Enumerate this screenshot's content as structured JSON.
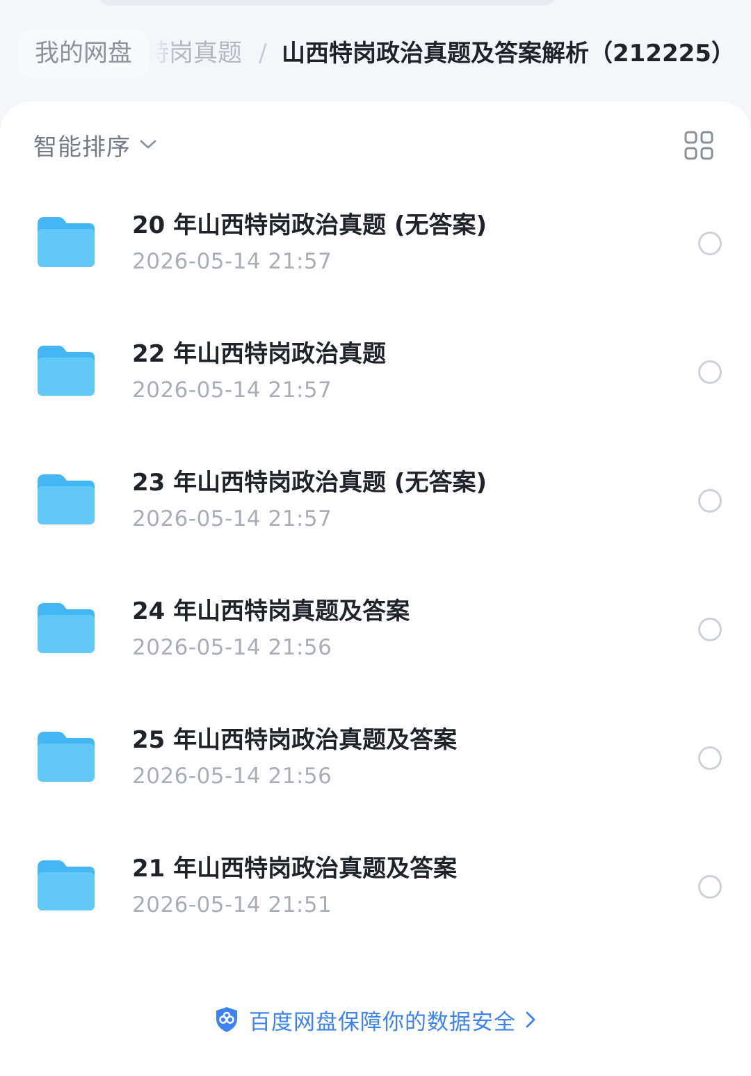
{
  "breadcrumb": {
    "root": "我的网盘",
    "middle": "特岗真题",
    "separator": "/",
    "current": "山西特岗政治真题及答案解析（212225）"
  },
  "toolbar": {
    "sort_label": "智能排序",
    "sort_icon": "chevron-down-icon",
    "view_icon": "grid-view-icon"
  },
  "files": [
    {
      "name": "20 年山西特岗政治真题 (无答案)",
      "date": "2026-05-14 21:57"
    },
    {
      "name": "22 年山西特岗政治真题",
      "date": "2026-05-14 21:57"
    },
    {
      "name": "23 年山西特岗政治真题 (无答案)",
      "date": "2026-05-14 21:57"
    },
    {
      "name": "24 年山西特岗真题及答案",
      "date": "2026-05-14 21:56"
    },
    {
      "name": "25 年山西特岗政治真题及答案",
      "date": "2026-05-14 21:56"
    },
    {
      "name": "21 年山西特岗政治真题及答案",
      "date": "2026-05-14 21:51"
    }
  ],
  "footer": {
    "security_text": "百度网盘保障你的数据安全"
  },
  "colors": {
    "accent": "#3c82f0",
    "folder": "#5ec5f8"
  }
}
